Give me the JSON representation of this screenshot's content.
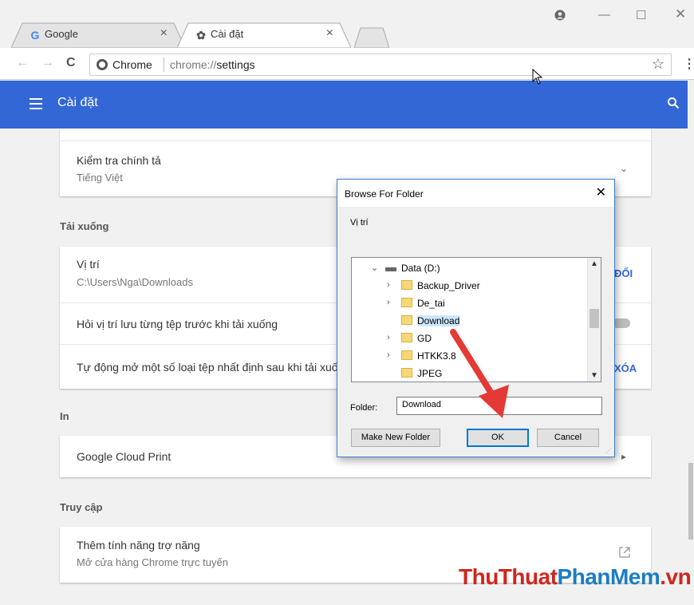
{
  "browser": {
    "tabs": [
      {
        "title": "Google",
        "favicon": "G",
        "active": false
      },
      {
        "title": "Cài đặt",
        "favicon": "gear-icon",
        "active": true
      }
    ],
    "omnibox": {
      "chip": "Chrome",
      "url_scheme": "chrome://",
      "url_path": "settings"
    }
  },
  "header": {
    "title": "Cài đặt"
  },
  "settings": {
    "spellcheck": {
      "title": "Kiểm tra chính tả",
      "value": "Tiếng Việt"
    },
    "downloads_section": "Tải xuống",
    "location": {
      "title": "Vị trí",
      "value": "C:\\Users\\Nga\\Downloads",
      "action": "ĐỔI"
    },
    "ask_where": {
      "title": "Hỏi vị trí lưu từng tệp trước khi tải xuống"
    },
    "auto_open": {
      "title": "Tự động mở một số loại tệp nhất định sau khi tải xuố",
      "action": "XÓA"
    },
    "print_section": "In",
    "cloud_print": {
      "title": "Google Cloud Print"
    },
    "access_section": "Truy cập",
    "accessibility": {
      "title": "Thêm tính năng trợ năng",
      "value": "Mở cửa hàng Chrome trực tuyến"
    }
  },
  "dialog": {
    "title": "Browse For Folder",
    "label": "Vị trí",
    "tree": {
      "drive": "Data (D:)",
      "folders": [
        {
          "name": "Backup_Driver",
          "expandable": true
        },
        {
          "name": "De_tai",
          "expandable": true
        },
        {
          "name": "Download",
          "expandable": false,
          "selected": true
        },
        {
          "name": "GD",
          "expandable": true
        },
        {
          "name": "HTKK3.8",
          "expandable": true
        },
        {
          "name": "JPEG",
          "expandable": false
        }
      ]
    },
    "folder_label": "Folder:",
    "folder_value": "Download",
    "buttons": {
      "new_folder": "Make New Folder",
      "ok": "OK",
      "cancel": "Cancel"
    }
  },
  "watermark": {
    "part1": "ThuThuat",
    "part2": "PhanMem",
    "part3": ".vn"
  },
  "colors": {
    "header_blue": "#3367d6",
    "arrow_red": "#e53935",
    "selection": "#cce8ff"
  }
}
